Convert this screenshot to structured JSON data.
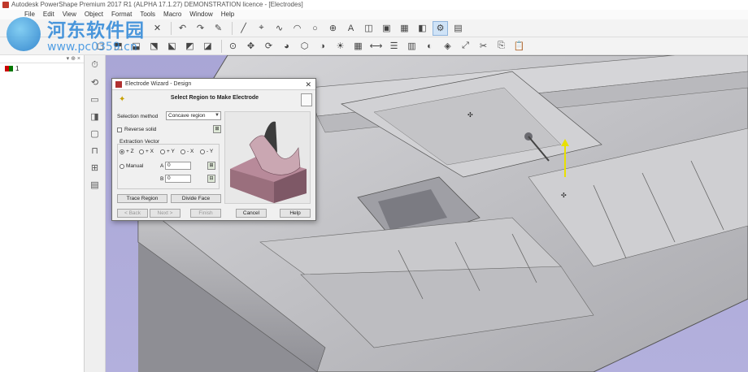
{
  "window": {
    "title": "Autodesk PowerShape Premium 2017 R1 (ALPHA 17.1.27) DEMONSTRATION licence - [Electrodes]"
  },
  "menu": [
    "File",
    "Edit",
    "View",
    "Object",
    "Format",
    "Tools",
    "Macro",
    "Window",
    "Help"
  ],
  "watermark": {
    "title": "河东软件园",
    "url": "www.pc0359.cn"
  },
  "tree": {
    "header": "▾ ⊕ ×",
    "items": [
      {
        "label": "1"
      }
    ]
  },
  "dialog": {
    "title": "Electrode Wizard - Design",
    "heading": "Select Region to Make Electrode",
    "selection_method_label": "Selection method",
    "selection_method_value": "Concave region",
    "reverse_solid_label": "Reverse solid",
    "extraction_vector_label": "Extraction Vector",
    "vectors": [
      "+ Z",
      "+ X",
      "+ Y",
      "- X",
      "- Y"
    ],
    "selected_vector": "+ Z",
    "manual_label": "Manual",
    "a_label": "A",
    "a_value": "0",
    "b_label": "B",
    "b_value": "0",
    "buttons": {
      "trace_region": "Trace Region",
      "divide_face": "Divide Face",
      "back": "< Back",
      "next": "Next >",
      "finish": "Finish",
      "cancel": "Cancel",
      "help": "Help"
    }
  },
  "colors": {
    "viewport": "#aeabd9",
    "model": "#c9c9cc",
    "accent_yellow": "#e8e000",
    "preview_copper": "#b88a9a"
  }
}
